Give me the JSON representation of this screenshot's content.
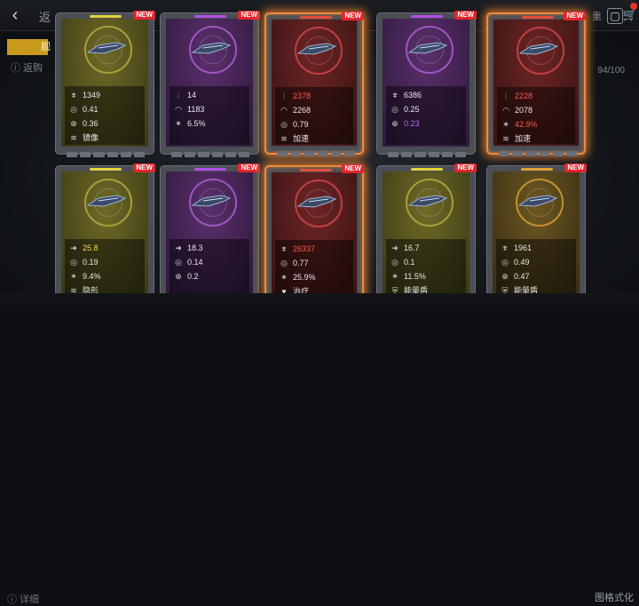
{
  "topbar": {
    "back_icon": "chevron-left-icon",
    "title_fragment": "返",
    "right_fragment": "重",
    "coin_icon": "square-icon",
    "cart_icon": "cart-icon"
  },
  "left_tab_fragment": "舰",
  "info_fragment": "ⓘ 返购",
  "count_fragment": "94/100",
  "bottom": {
    "detail_fragment": "ⓘ 详细",
    "format_fragment": "图格式化"
  },
  "new_badge": "NEW",
  "cards": [
    {
      "tier": "yellow",
      "selected": false,
      "stats": [
        {
          "icon": "attack-icon",
          "value": "1349",
          "color": "normal"
        },
        {
          "icon": "target-icon",
          "value": "0.41",
          "color": "normal"
        },
        {
          "icon": "crosshair-icon",
          "value": "0.36",
          "color": "normal"
        },
        {
          "icon": "skill-icon",
          "value": "镜像",
          "color": "normal"
        }
      ]
    },
    {
      "tier": "purple",
      "selected": false,
      "stats": [
        {
          "icon": "ammo-icon",
          "value": "14",
          "color": "normal"
        },
        {
          "icon": "range-icon",
          "value": "1183",
          "color": "normal"
        },
        {
          "icon": "crit-icon",
          "value": "6.5%",
          "color": "normal"
        }
      ]
    },
    {
      "tier": "red",
      "selected": true,
      "stats": [
        {
          "icon": "ammo-icon",
          "value": "2378",
          "color": "red"
        },
        {
          "icon": "range-icon",
          "value": "2268",
          "color": "normal"
        },
        {
          "icon": "target-icon",
          "value": "0.79",
          "color": "normal"
        },
        {
          "icon": "skill-icon",
          "value": "加速",
          "color": "normal"
        }
      ]
    },
    {
      "tier": "purple",
      "selected": false,
      "stats": [
        {
          "icon": "attack-icon",
          "value": "6386",
          "color": "normal"
        },
        {
          "icon": "target-icon",
          "value": "0.25",
          "color": "normal"
        },
        {
          "icon": "crosshair-icon",
          "value": "0.23",
          "color": "purple"
        }
      ]
    },
    {
      "tier": "red",
      "selected": true,
      "stats": [
        {
          "icon": "ammo-icon",
          "value": "2228",
          "color": "red"
        },
        {
          "icon": "range-icon",
          "value": "2078",
          "color": "normal"
        },
        {
          "icon": "crit-icon",
          "value": "42.9%",
          "color": "red"
        },
        {
          "icon": "skill-icon",
          "value": "加速",
          "color": "normal"
        }
      ]
    },
    {
      "tier": "yellow",
      "selected": false,
      "stats": [
        {
          "icon": "speed-icon",
          "value": "25.8",
          "color": "yellow"
        },
        {
          "icon": "target-icon",
          "value": "0.19",
          "color": "normal"
        },
        {
          "icon": "crit-icon",
          "value": "9.4%",
          "color": "normal"
        },
        {
          "icon": "skill-icon",
          "value": "隐形",
          "color": "normal"
        }
      ]
    },
    {
      "tier": "purple",
      "selected": false,
      "stats": [
        {
          "icon": "speed-icon",
          "value": "18.3",
          "color": "normal"
        },
        {
          "icon": "target-icon",
          "value": "0.14",
          "color": "normal"
        },
        {
          "icon": "crosshair-icon",
          "value": "0.2",
          "color": "normal"
        }
      ]
    },
    {
      "tier": "red",
      "selected": true,
      "stats": [
        {
          "icon": "attack-icon",
          "value": "26337",
          "color": "red"
        },
        {
          "icon": "target-icon",
          "value": "0.77",
          "color": "normal"
        },
        {
          "icon": "crit-icon",
          "value": "25.9%",
          "color": "normal"
        },
        {
          "icon": "heal-icon",
          "value": "治疗",
          "color": "normal"
        }
      ]
    },
    {
      "tier": "yellow",
      "selected": false,
      "stats": [
        {
          "icon": "speed-icon",
          "value": "16.7",
          "color": "normal"
        },
        {
          "icon": "target-icon",
          "value": "0.1",
          "color": "normal"
        },
        {
          "icon": "crit-icon",
          "value": "11.5%",
          "color": "normal"
        },
        {
          "icon": "shield-icon",
          "value": "能量盾",
          "color": "normal"
        }
      ]
    },
    {
      "tier": "orange",
      "selected": false,
      "stats": [
        {
          "icon": "attack-icon",
          "value": "1961",
          "color": "normal"
        },
        {
          "icon": "target-icon",
          "value": "0.49",
          "color": "normal"
        },
        {
          "icon": "crosshair-icon",
          "value": "0.47",
          "color": "normal"
        },
        {
          "icon": "shield-icon",
          "value": "能量盾",
          "color": "normal"
        }
      ]
    }
  ]
}
